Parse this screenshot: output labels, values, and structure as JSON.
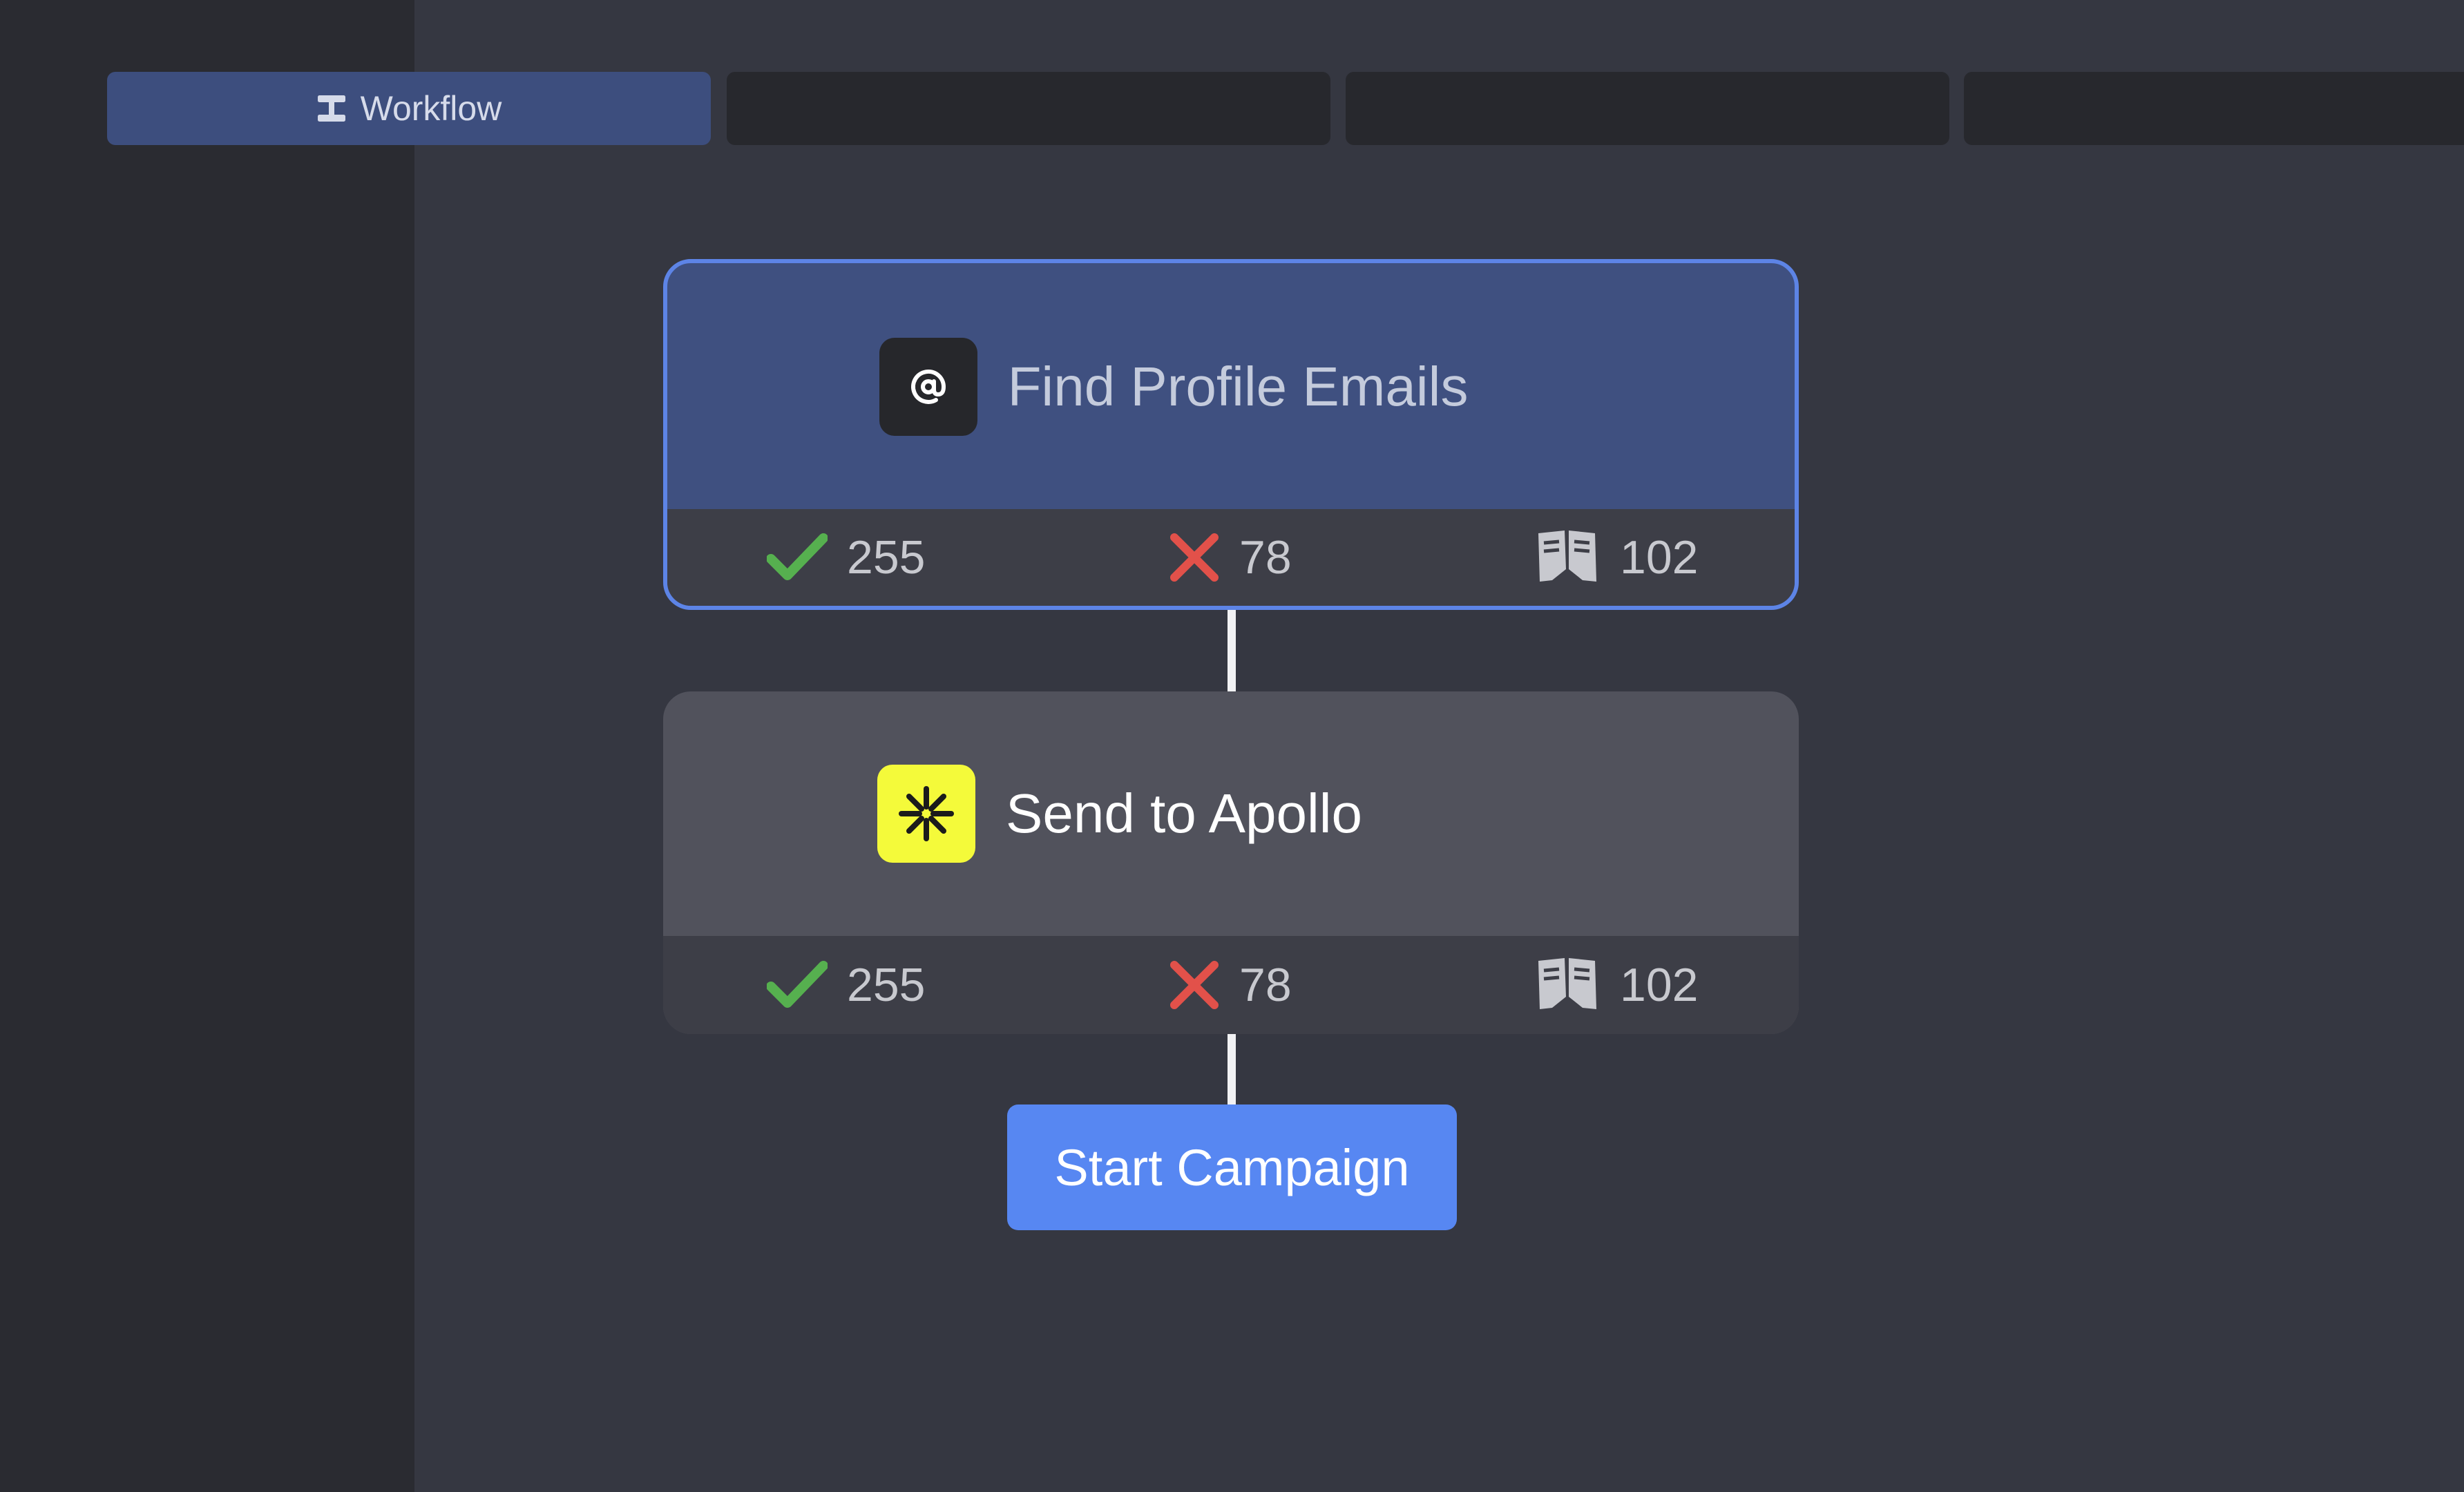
{
  "tabs": [
    {
      "label": "Workflow",
      "icon": "workflow-icon",
      "active": true
    },
    {
      "label": "",
      "active": false
    },
    {
      "label": "",
      "active": false
    },
    {
      "label": "",
      "active": false
    }
  ],
  "workflow": {
    "nodes": [
      {
        "title": "Find Profile Emails",
        "icon": "at-sign-icon",
        "stats": {
          "success": "255",
          "failed": "78",
          "skipped": "102"
        }
      },
      {
        "title": "Send to Apollo",
        "icon": "apollo-logo-icon",
        "stats": {
          "success": "255",
          "failed": "78",
          "skipped": "102"
        }
      }
    ],
    "start_button": "Start Campaign"
  },
  "colors": {
    "background": "#353741",
    "sidebar": "#2a2b31",
    "active_tab": "#3d4e7e",
    "selected_node": "#3f5080",
    "selected_border": "#5d84e6",
    "node": "#51525c",
    "success": "#56b04f",
    "failed": "#e2514a",
    "button": "#5787f2",
    "apollo_yellow": "#f4fa3a"
  }
}
